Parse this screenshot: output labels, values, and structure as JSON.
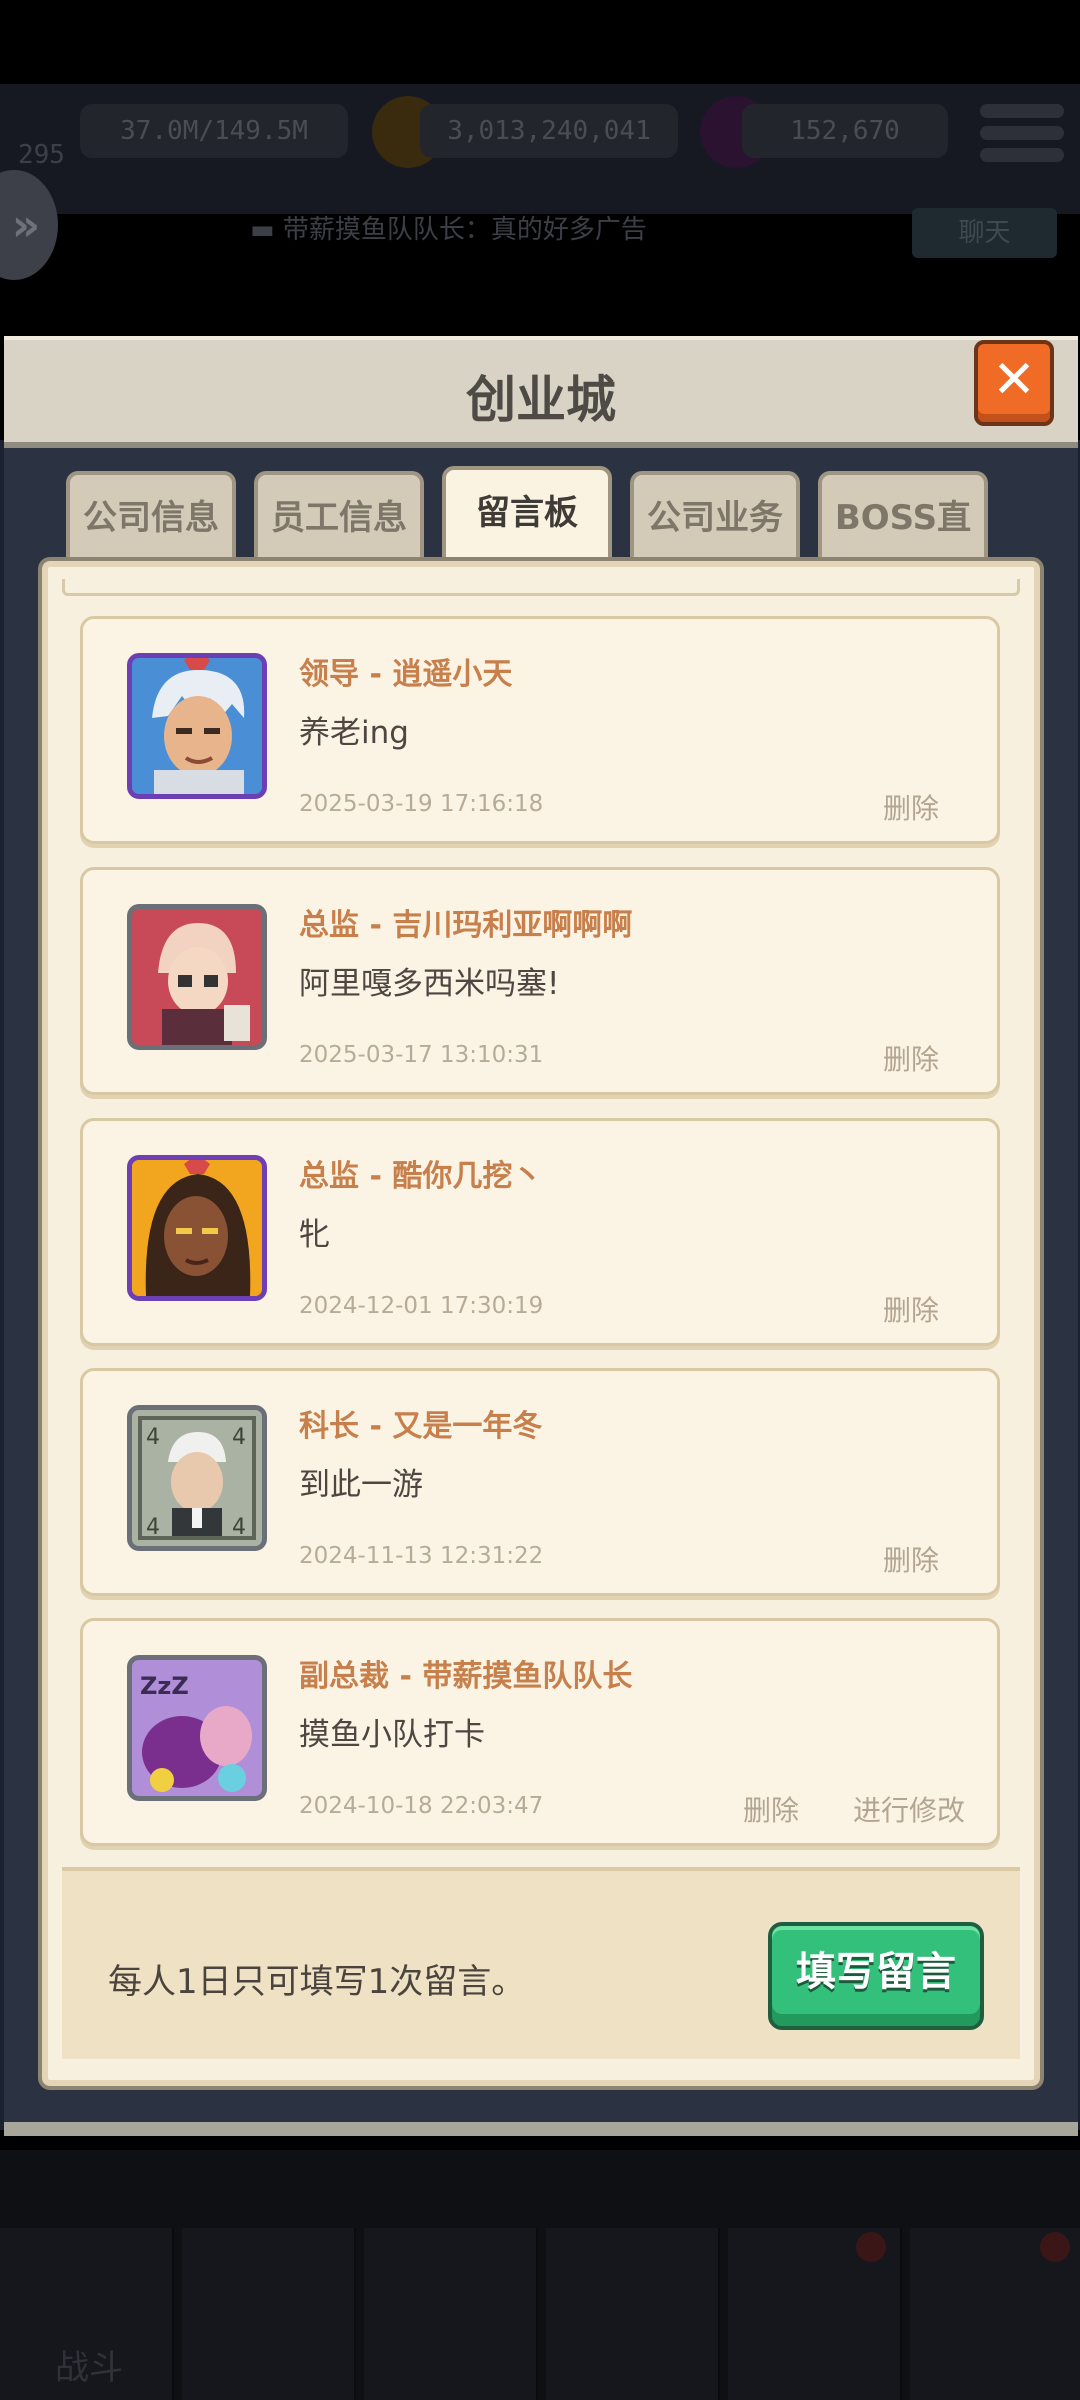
{
  "background": {
    "resources": [
      {
        "value": "37.0M/149.5M",
        "icon": "energy-icon"
      },
      {
        "value": "3,013,240,041",
        "icon": "gold-coin-icon"
      },
      {
        "value": "152,670",
        "icon": "gem-icon"
      }
    ],
    "level_text": "295",
    "chat_preview": "带薪摸鱼队队长：真的好多广告",
    "chat_button": "聊天",
    "nav_battle_label": "战斗"
  },
  "modal": {
    "title": "创业城",
    "close_icon": "close-icon",
    "tabs": [
      {
        "label": "公司信息",
        "active": false
      },
      {
        "label": "员工信息",
        "active": false
      },
      {
        "label": "留言板",
        "active": true
      },
      {
        "label": "公司业务",
        "active": false
      },
      {
        "label": "BOSS直聘",
        "active": false
      }
    ],
    "messages": [
      {
        "author": "领导 - 逍遥小天",
        "text": "养老ing",
        "time": "2025-03-19 17:16:18",
        "delete": "删除"
      },
      {
        "author": "总监 - 吉川玛利亚啊啊啊",
        "text": "阿里嘎多西米吗塞!",
        "time": "2025-03-17 13:10:31",
        "delete": "删除"
      },
      {
        "author": "总监 - 酷你几挖丶",
        "text": "牝",
        "time": "2024-12-01 17:30:19",
        "delete": "删除"
      },
      {
        "author": "科长 - 又是一年冬",
        "text": "到此一游",
        "time": "2024-11-13 12:31:22",
        "delete": "删除"
      },
      {
        "author": "副总裁 - 带薪摸鱼队队长",
        "text": "摸鱼小队打卡",
        "time": "2024-10-18 22:03:47",
        "delete": "删除",
        "edit": "进行修改"
      }
    ],
    "footer_note": "每人1日只可填写1次留言。",
    "write_button": "填写留言"
  },
  "colors": {
    "author": "#c77f4b",
    "button_green": "#32c07a",
    "close_orange": "#ef6b26",
    "panel": "#f8f0df"
  }
}
